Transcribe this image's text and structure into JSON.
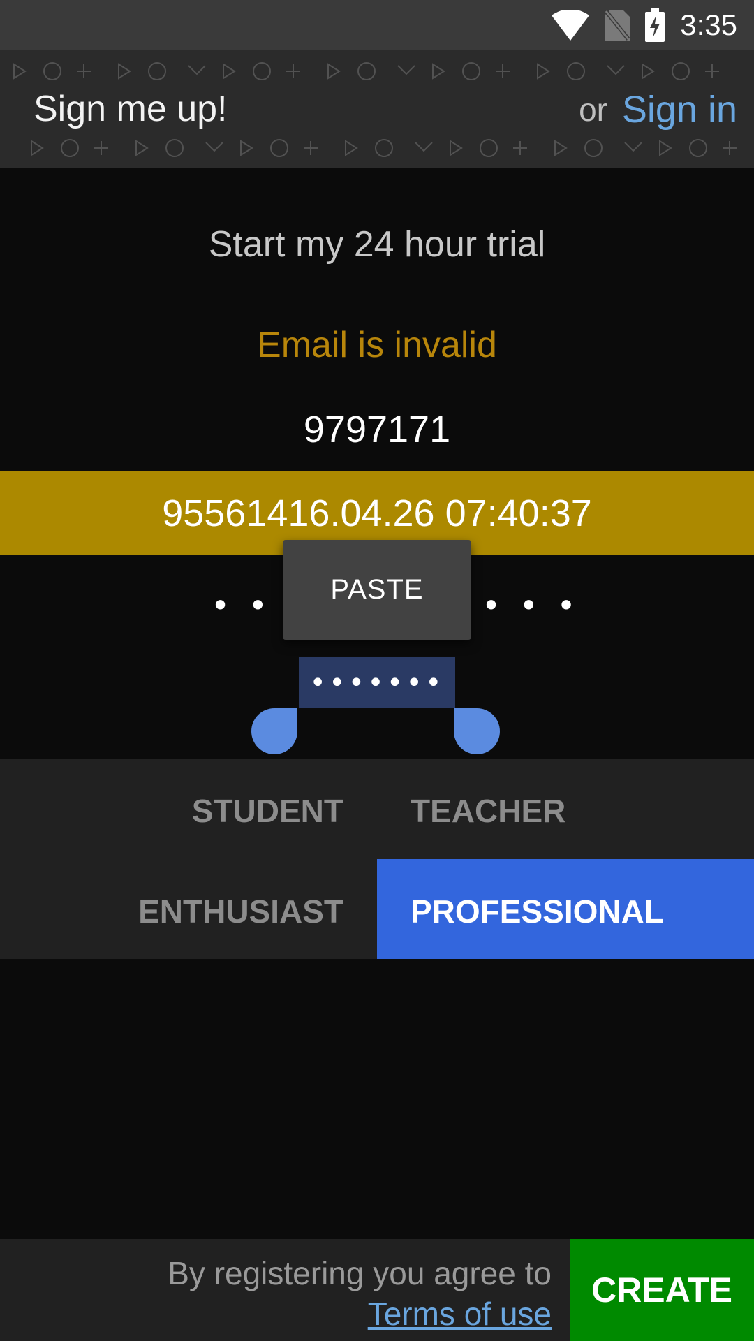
{
  "status_bar": {
    "time": "3:35",
    "icons": [
      "wifi-icon",
      "no-sim-icon",
      "battery-charging-icon"
    ]
  },
  "header": {
    "title": "Sign me up!",
    "or_text": "or",
    "sign_in_label": "Sign in"
  },
  "form": {
    "trial_title": "Start my 24 hour trial",
    "error_message": "Email is invalid",
    "username_value": "9797171",
    "email_value": "95561416.04.26 07:40:37",
    "dots_left": "• • •",
    "dots_right": "• • •",
    "password_value": "•••••••",
    "context_menu": {
      "paste_label": "PASTE"
    }
  },
  "roles": {
    "items": [
      {
        "label": "STUDENT",
        "selected": false
      },
      {
        "label": "TEACHER",
        "selected": false
      },
      {
        "label": "ENTHUSIAST",
        "selected": false
      },
      {
        "label": "PROFESSIONAL",
        "selected": true
      }
    ]
  },
  "footer": {
    "agree_text": "By registering you agree to",
    "terms_link": "Terms of use",
    "create_label": "CREATE"
  },
  "colors": {
    "accent_blue": "#3366dd",
    "link_blue": "#6aa6df",
    "error_gold": "#b8860b",
    "field_highlight": "#ac8900",
    "create_green": "#008a00"
  }
}
